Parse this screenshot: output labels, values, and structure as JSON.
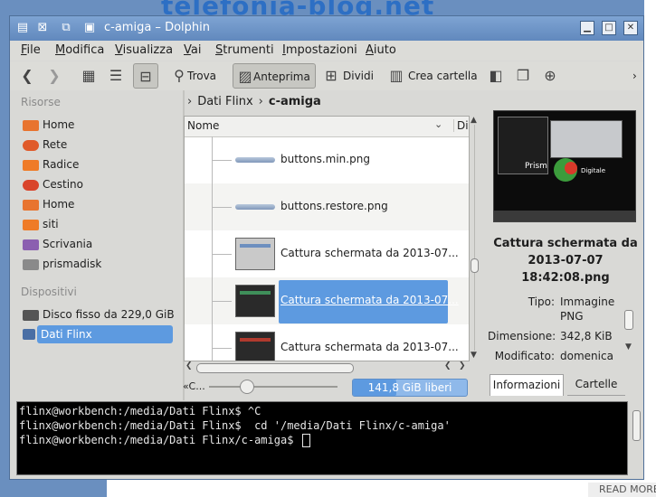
{
  "background": {
    "site_logo": "telefonia-blog.net",
    "read_more": "READ MORE"
  },
  "window": {
    "title": "c-amiga – Dolphin",
    "accent": "#5d9ae0"
  },
  "menu": [
    "File",
    "Modifica",
    "Visualizza",
    "Vai",
    "Strumenti",
    "Impostazioni",
    "Aiuto"
  ],
  "toolbar": {
    "back_icon": "back-arrow-icon",
    "forward_icon": "forward-arrow-icon",
    "trova": "Trova",
    "anteprima": "Anteprima",
    "dividi": "Dividi",
    "crea_cartella": "Crea cartella",
    "more": "›"
  },
  "places": {
    "risorse_title": "Risorse",
    "items": [
      "Home",
      "Rete",
      "Radice",
      "Cestino",
      "Home",
      "siti",
      "Scrivania",
      "prismadisk"
    ],
    "dispositivi_title": "Dispositivi",
    "devices": [
      "Disco fisso da 229,0 GiB",
      "Dati Flinx"
    ]
  },
  "breadcrumb": {
    "parent": "Dati Flinx",
    "current": "c-amiga"
  },
  "filelist": {
    "col_name": "Nome",
    "col_dir": "Dir",
    "files": [
      "buttons.min.png",
      "buttons.restore.png",
      "Cattura schermata da 2013-07...",
      "Cattura schermata da 2013-07...",
      "Cattura schermata da 2013-07..."
    ],
    "selected_index": 3
  },
  "statusbar": {
    "text": "«C...",
    "free_space": "141,8 GiB liberi",
    "used_fraction": 0.38
  },
  "info": {
    "title": "Cattura schermata da 2013-07-07 18:42:08.png",
    "tipo_label": "Tipo:",
    "tipo_value_1": "Immagine",
    "tipo_value_2": "PNG",
    "dimensione_label": "Dimensione:",
    "dimensione_value": "342,8 KiB",
    "modificato_label": "Modificato:",
    "modificato_value": "domenica",
    "preview_brand": "Prism",
    "preview_sub": "Digitale"
  },
  "panel_tabs": {
    "info": "Informazioni",
    "cartelle": "Cartelle"
  },
  "terminal": {
    "lines": [
      "flinx@workbench:/media/Dati Flinx$ ^C",
      "flinx@workbench:/media/Dati Flinx$  cd '/media/Dati Flinx/c-amiga'",
      "flinx@workbench:/media/Dati Flinx/c-amiga$ "
    ]
  }
}
